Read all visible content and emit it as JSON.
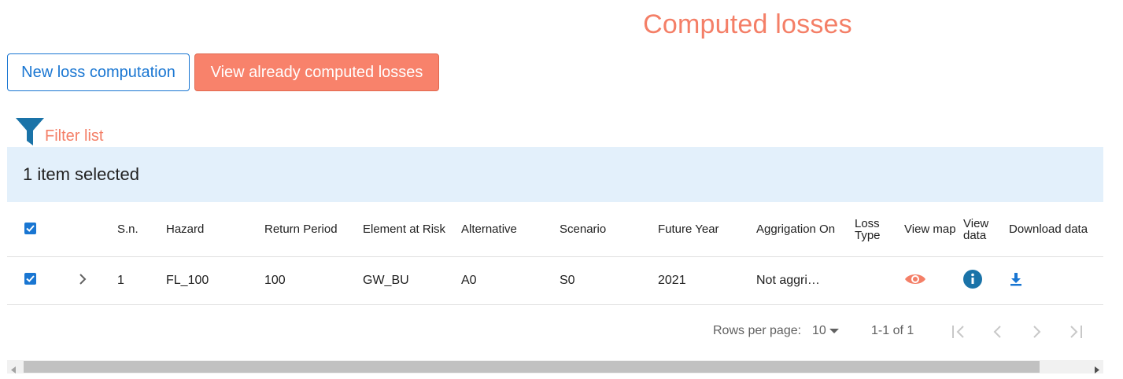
{
  "page": {
    "title": "Computed losses"
  },
  "actions": {
    "new_loss_label": "New loss computation",
    "view_losses_label": "View already computed losses"
  },
  "filter": {
    "label": "Filter list",
    "icon": "filter-icon"
  },
  "selection": {
    "text": "1 item selected"
  },
  "table": {
    "columns": {
      "sn": "S.n.",
      "hazard": "Hazard",
      "return_period": "Return Period",
      "element_at_risk": "Element at Risk",
      "alternative": "Alternative",
      "scenario": "Scenario",
      "future_year": "Future Year",
      "aggregation_on": "Aggrigation On",
      "loss_type": "Loss Type",
      "view_map": "View map",
      "view_data": "View data",
      "download_data": "Download data"
    },
    "rows": [
      {
        "checked": true,
        "sn": "1",
        "hazard": "FL_100",
        "return_period": "100",
        "element_at_risk": "GW_BU",
        "alternative": "A0",
        "scenario": "S0",
        "future_year": "2021",
        "aggregation_on": "Not aggri…",
        "loss_type": "",
        "icons": {
          "view_map": "eye-icon",
          "view_data": "info-icon",
          "download": "download-icon"
        }
      }
    ]
  },
  "pagination": {
    "rows_per_page_label": "Rows per page:",
    "rows_per_page_value": "10",
    "range_text": "1-1 of 1"
  },
  "colors": {
    "accent": "#f47f67",
    "primary": "#1976d2",
    "selection_bg": "#e3f0fb",
    "info_icon": "#1a73a8"
  }
}
